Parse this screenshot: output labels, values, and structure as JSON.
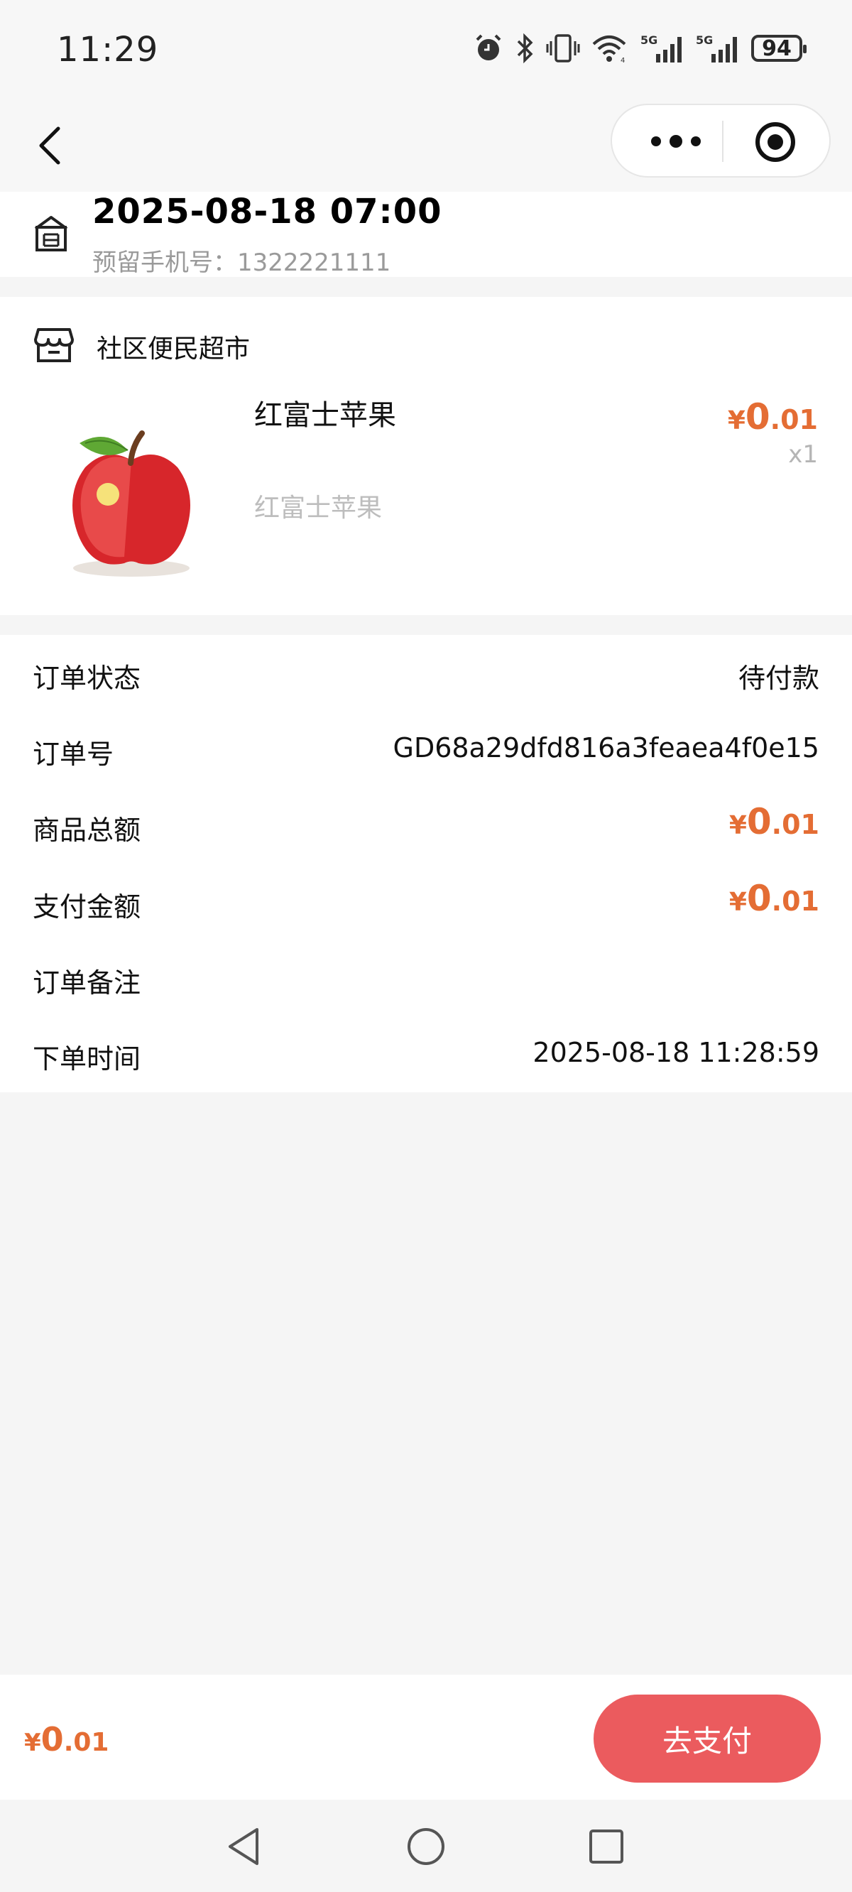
{
  "status_bar": {
    "time": "11:29",
    "battery": "94",
    "icons": [
      "alarm-icon",
      "bluetooth-icon",
      "vibrate-icon",
      "wifi-icon",
      "signal-5g-icon",
      "signal-5g-icon",
      "battery-icon"
    ],
    "network_label_1": "5G",
    "network_label_2": "5G"
  },
  "nav": {
    "back_icon": "chevron-left-icon",
    "more_icon": "more-icon",
    "close_icon": "target-icon"
  },
  "pickup": {
    "time": "2025-08-18 07:00",
    "phone": "预留手机号：1322221111",
    "icon": "building-icon"
  },
  "store": {
    "name": "社区便民超市",
    "icon": "shop-icon"
  },
  "product": {
    "name": "红富士苹果",
    "subtitle": "红富士苹果",
    "price_currency": "¥",
    "price_int": "0",
    "price_dec": ".01",
    "quantity": "x1",
    "image": "apple-image"
  },
  "order_info": {
    "status_label": "订单状态",
    "status_value": "待付款",
    "number_label": "订单号",
    "number_value": "GD68a29dfd816a3feaea4f0e15",
    "goods_total_label": "商品总额",
    "goods_total": {
      "currency": "¥",
      "int": "0",
      "dec": ".01"
    },
    "pay_amount_label": "支付金额",
    "pay_amount": {
      "currency": "¥",
      "int": "0",
      "dec": ".01"
    },
    "remark_label": "订单备注",
    "remark_value": "",
    "order_time_label": "下单时间",
    "order_time_value": "2025-08-18 11:28:59"
  },
  "bottom_bar": {
    "total": {
      "currency": "¥",
      "int": "0",
      "dec": ".01"
    },
    "pay_button": "去支付"
  },
  "colors": {
    "price": "#e46d34",
    "pay_button": "#eb5b5e",
    "background": "#f5f5f5"
  }
}
